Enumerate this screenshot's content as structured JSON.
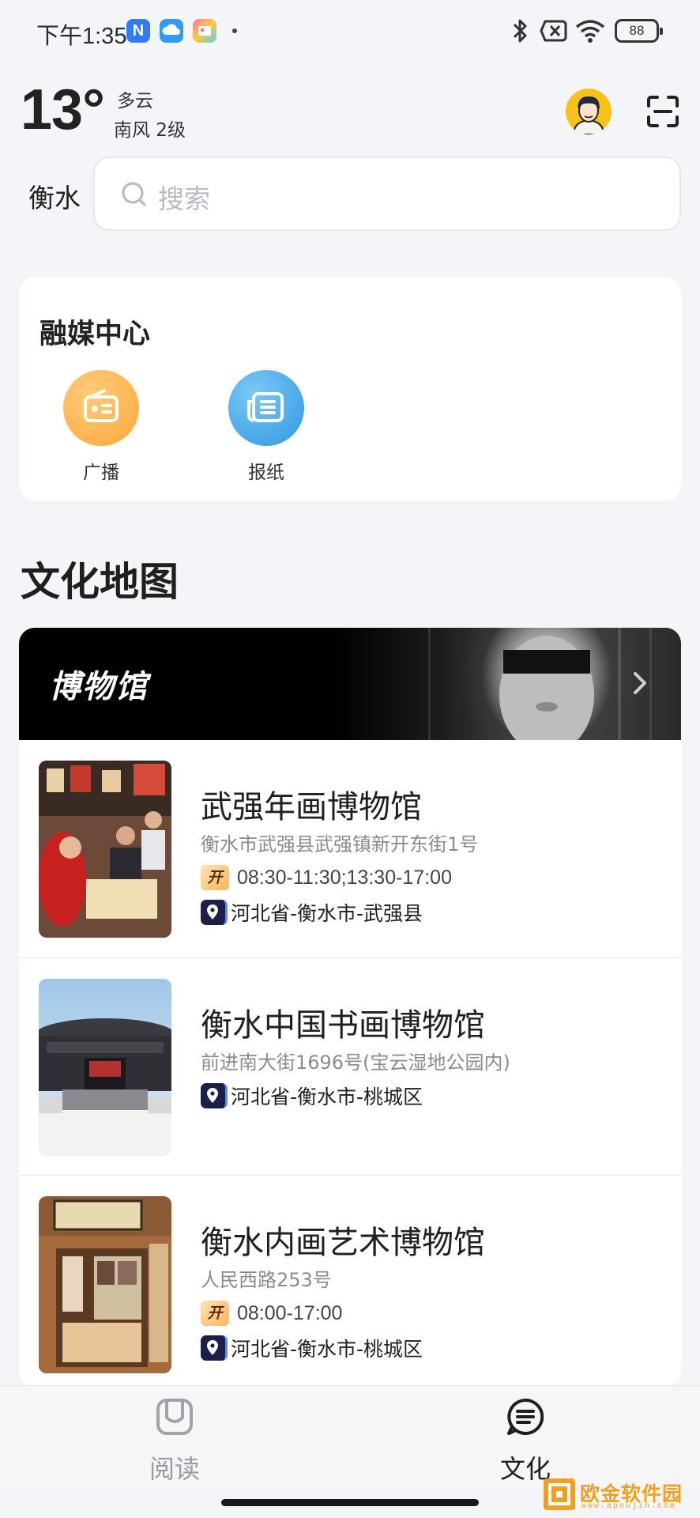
{
  "status_bar": {
    "time": "下午1:35",
    "battery": "88",
    "icons": [
      "notification-n-icon",
      "cloud-icon",
      "gallery-icon",
      "bluetooth-icon",
      "sim-off-icon",
      "wifi-icon",
      "battery-icon"
    ]
  },
  "weather": {
    "temperature": "13°",
    "condition": "多云",
    "wind": "南风 2级"
  },
  "location": {
    "city": "衡水"
  },
  "search": {
    "placeholder": "搜索"
  },
  "media_center": {
    "title": "融媒中心",
    "items": [
      {
        "label": "广播",
        "icon": "radio-icon",
        "color": "#ffb04a"
      },
      {
        "label": "报纸",
        "icon": "newspaper-icon",
        "color": "#3aa3e8"
      }
    ]
  },
  "culture_map": {
    "title": "文化地图",
    "banner_title": "博物馆",
    "museums": [
      {
        "name": "武强年画博物馆",
        "address": "衡水市武强县武强镇新开东街1号",
        "open_badge": "开",
        "hours": "08:30-11:30;13:30-17:00",
        "region": "河北省-衡水市-武强县"
      },
      {
        "name": "衡水中国书画博物馆",
        "address": "前进南大街1696号(宝云湿地公园内)",
        "region": "河北省-衡水市-桃城区"
      },
      {
        "name": "衡水内画艺术博物馆",
        "address": "人民西路253号",
        "open_badge": "开",
        "hours": "08:00-17:00",
        "region": "河北省-衡水市-桃城区"
      }
    ]
  },
  "tabs": [
    {
      "label": "阅读",
      "icon": "read-icon",
      "active": false
    },
    {
      "label": "文化",
      "icon": "culture-icon",
      "active": true
    }
  ],
  "colors": {
    "accent_orange": "#ffb04a",
    "accent_blue": "#3aa3e8",
    "background": "#f4f5f9",
    "tab_inactive": "#9a9aa0",
    "tab_active": "#1f1f1f"
  },
  "watermark": {
    "text": "欧金软件园",
    "sub": "www.apoujin.com"
  }
}
